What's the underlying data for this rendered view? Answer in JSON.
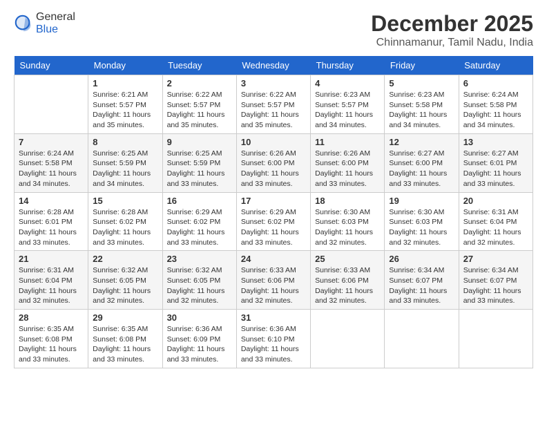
{
  "header": {
    "logo": {
      "general": "General",
      "blue": "Blue"
    },
    "title": "December 2025",
    "location": "Chinnamanur, Tamil Nadu, India"
  },
  "weekdays": [
    "Sunday",
    "Monday",
    "Tuesday",
    "Wednesday",
    "Thursday",
    "Friday",
    "Saturday"
  ],
  "weeks": [
    [
      {
        "day": "",
        "info": ""
      },
      {
        "day": "1",
        "info": "Sunrise: 6:21 AM\nSunset: 5:57 PM\nDaylight: 11 hours\nand 35 minutes."
      },
      {
        "day": "2",
        "info": "Sunrise: 6:22 AM\nSunset: 5:57 PM\nDaylight: 11 hours\nand 35 minutes."
      },
      {
        "day": "3",
        "info": "Sunrise: 6:22 AM\nSunset: 5:57 PM\nDaylight: 11 hours\nand 35 minutes."
      },
      {
        "day": "4",
        "info": "Sunrise: 6:23 AM\nSunset: 5:57 PM\nDaylight: 11 hours\nand 34 minutes."
      },
      {
        "day": "5",
        "info": "Sunrise: 6:23 AM\nSunset: 5:58 PM\nDaylight: 11 hours\nand 34 minutes."
      },
      {
        "day": "6",
        "info": "Sunrise: 6:24 AM\nSunset: 5:58 PM\nDaylight: 11 hours\nand 34 minutes."
      }
    ],
    [
      {
        "day": "7",
        "info": "Sunrise: 6:24 AM\nSunset: 5:58 PM\nDaylight: 11 hours\nand 34 minutes."
      },
      {
        "day": "8",
        "info": "Sunrise: 6:25 AM\nSunset: 5:59 PM\nDaylight: 11 hours\nand 34 minutes."
      },
      {
        "day": "9",
        "info": "Sunrise: 6:25 AM\nSunset: 5:59 PM\nDaylight: 11 hours\nand 33 minutes."
      },
      {
        "day": "10",
        "info": "Sunrise: 6:26 AM\nSunset: 6:00 PM\nDaylight: 11 hours\nand 33 minutes."
      },
      {
        "day": "11",
        "info": "Sunrise: 6:26 AM\nSunset: 6:00 PM\nDaylight: 11 hours\nand 33 minutes."
      },
      {
        "day": "12",
        "info": "Sunrise: 6:27 AM\nSunset: 6:00 PM\nDaylight: 11 hours\nand 33 minutes."
      },
      {
        "day": "13",
        "info": "Sunrise: 6:27 AM\nSunset: 6:01 PM\nDaylight: 11 hours\nand 33 minutes."
      }
    ],
    [
      {
        "day": "14",
        "info": "Sunrise: 6:28 AM\nSunset: 6:01 PM\nDaylight: 11 hours\nand 33 minutes."
      },
      {
        "day": "15",
        "info": "Sunrise: 6:28 AM\nSunset: 6:02 PM\nDaylight: 11 hours\nand 33 minutes."
      },
      {
        "day": "16",
        "info": "Sunrise: 6:29 AM\nSunset: 6:02 PM\nDaylight: 11 hours\nand 33 minutes."
      },
      {
        "day": "17",
        "info": "Sunrise: 6:29 AM\nSunset: 6:02 PM\nDaylight: 11 hours\nand 33 minutes."
      },
      {
        "day": "18",
        "info": "Sunrise: 6:30 AM\nSunset: 6:03 PM\nDaylight: 11 hours\nand 32 minutes."
      },
      {
        "day": "19",
        "info": "Sunrise: 6:30 AM\nSunset: 6:03 PM\nDaylight: 11 hours\nand 32 minutes."
      },
      {
        "day": "20",
        "info": "Sunrise: 6:31 AM\nSunset: 6:04 PM\nDaylight: 11 hours\nand 32 minutes."
      }
    ],
    [
      {
        "day": "21",
        "info": "Sunrise: 6:31 AM\nSunset: 6:04 PM\nDaylight: 11 hours\nand 32 minutes."
      },
      {
        "day": "22",
        "info": "Sunrise: 6:32 AM\nSunset: 6:05 PM\nDaylight: 11 hours\nand 32 minutes."
      },
      {
        "day": "23",
        "info": "Sunrise: 6:32 AM\nSunset: 6:05 PM\nDaylight: 11 hours\nand 32 minutes."
      },
      {
        "day": "24",
        "info": "Sunrise: 6:33 AM\nSunset: 6:06 PM\nDaylight: 11 hours\nand 32 minutes."
      },
      {
        "day": "25",
        "info": "Sunrise: 6:33 AM\nSunset: 6:06 PM\nDaylight: 11 hours\nand 32 minutes."
      },
      {
        "day": "26",
        "info": "Sunrise: 6:34 AM\nSunset: 6:07 PM\nDaylight: 11 hours\nand 33 minutes."
      },
      {
        "day": "27",
        "info": "Sunrise: 6:34 AM\nSunset: 6:07 PM\nDaylight: 11 hours\nand 33 minutes."
      }
    ],
    [
      {
        "day": "28",
        "info": "Sunrise: 6:35 AM\nSunset: 6:08 PM\nDaylight: 11 hours\nand 33 minutes."
      },
      {
        "day": "29",
        "info": "Sunrise: 6:35 AM\nSunset: 6:08 PM\nDaylight: 11 hours\nand 33 minutes."
      },
      {
        "day": "30",
        "info": "Sunrise: 6:36 AM\nSunset: 6:09 PM\nDaylight: 11 hours\nand 33 minutes."
      },
      {
        "day": "31",
        "info": "Sunrise: 6:36 AM\nSunset: 6:10 PM\nDaylight: 11 hours\nand 33 minutes."
      },
      {
        "day": "",
        "info": ""
      },
      {
        "day": "",
        "info": ""
      },
      {
        "day": "",
        "info": ""
      }
    ]
  ]
}
